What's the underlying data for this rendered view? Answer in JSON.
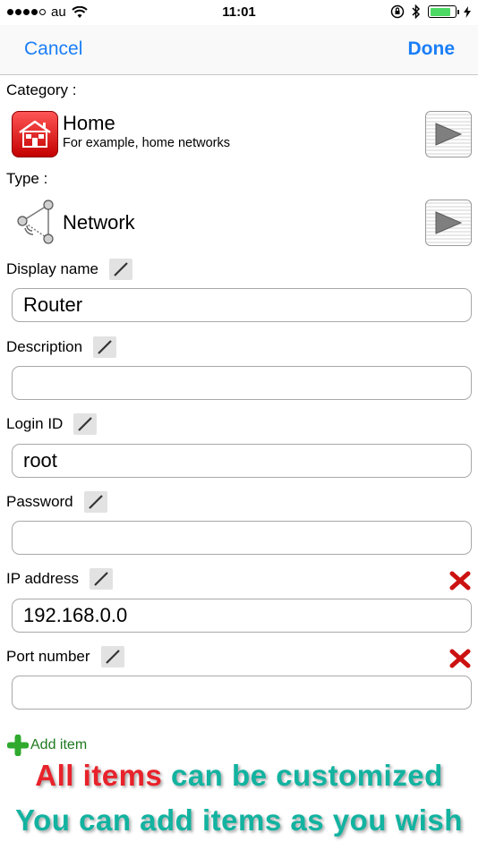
{
  "status_bar": {
    "carrier": "au",
    "time": "11:01",
    "battery_level": 0.85
  },
  "nav": {
    "cancel_label": "Cancel",
    "done_label": "Done"
  },
  "category": {
    "label": "Category :",
    "title": "Home",
    "subtitle": "For example, home networks"
  },
  "type": {
    "label": "Type :",
    "title": "Network"
  },
  "fields": [
    {
      "label": "Display name",
      "value": "Router"
    },
    {
      "label": "Description",
      "value": ""
    },
    {
      "label": "Login ID",
      "value": "root"
    },
    {
      "label": "Password",
      "value": ""
    },
    {
      "label": "IP address",
      "value": "192.168.0.0"
    },
    {
      "label": "Port number",
      "value": ""
    }
  ],
  "add_item_label": "Add item",
  "banner": {
    "line1_highlight": "All items",
    "line1_rest": " can be customized",
    "line2": "You can add items as you wish"
  },
  "colors": {
    "accent": "#1a7ef7",
    "highlight_red": "#e8222b",
    "banner_teal": "#12b3a0",
    "delete_red": "#cc1111",
    "add_green": "#2faa2f"
  }
}
